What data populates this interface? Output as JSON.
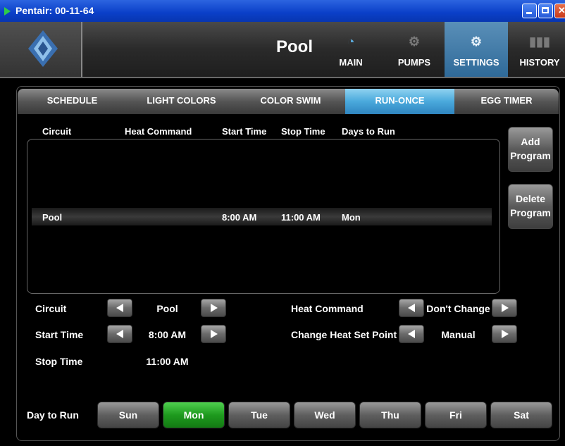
{
  "window": {
    "title": "Pentair: 00-11-64"
  },
  "header": {
    "page_title": "Pool",
    "nav": [
      {
        "label": "MAIN",
        "icon": "goggles-icon"
      },
      {
        "label": "PUMPS",
        "icon": "pump-icon"
      },
      {
        "label": "SETTINGS",
        "icon": "gear-icon"
      },
      {
        "label": "HISTORY",
        "icon": "bar-chart-icon"
      }
    ],
    "active_nav": "SETTINGS"
  },
  "tabs": {
    "items": [
      "SCHEDULE",
      "LIGHT COLORS",
      "COLOR SWIM",
      "RUN-ONCE",
      "EGG TIMER"
    ],
    "active": "RUN-ONCE"
  },
  "table": {
    "columns": [
      "Circuit",
      "Heat Command",
      "Start Time",
      "Stop Time",
      "Days to Run"
    ],
    "rows": [
      {
        "circuit": "Pool",
        "heat_command": "",
        "start": "8:00 AM",
        "stop": "11:00 AM",
        "days": "Mon"
      }
    ]
  },
  "side_buttons": {
    "add": {
      "line1": "Add",
      "line2": "Program"
    },
    "delete": {
      "line1": "Delete",
      "line2": "Program"
    }
  },
  "form": {
    "circuit_label": "Circuit",
    "circuit_value": "Pool",
    "start_label": "Start Time",
    "start_value": "8:00 AM",
    "stop_label": "Stop Time",
    "stop_value": "11:00 AM",
    "heat_label": "Heat Command",
    "heat_value": "Don't Change",
    "setpoint_label": "Change Heat Set Point",
    "setpoint_value": "Manual"
  },
  "days": {
    "label": "Day to Run",
    "items": [
      "Sun",
      "Mon",
      "Tue",
      "Wed",
      "Thu",
      "Fri",
      "Sat"
    ],
    "selected": "Mon"
  },
  "colors": {
    "active_tab": "#4aa9dc",
    "selected_day": "#1e9a1e",
    "active_nav": "#2f6a99"
  }
}
